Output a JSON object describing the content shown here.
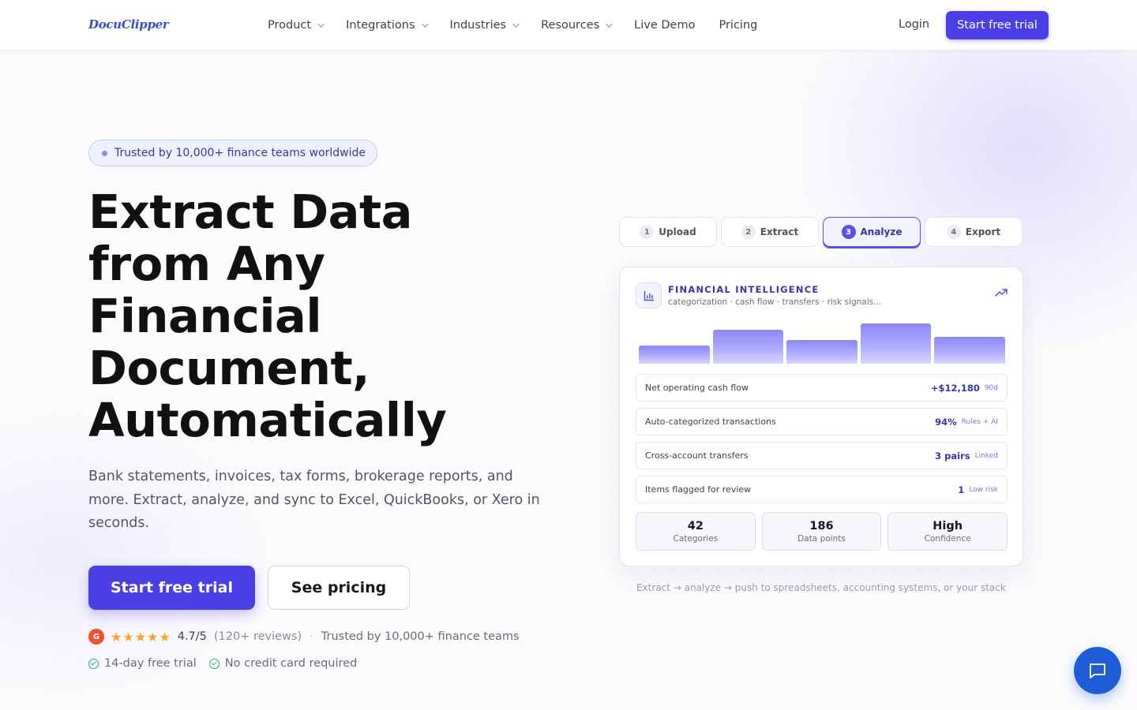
{
  "nav": {
    "logo": "DocuClipper",
    "links": [
      {
        "label": "Product",
        "dropdown": true
      },
      {
        "label": "Integrations",
        "dropdown": true
      },
      {
        "label": "Industries",
        "dropdown": true
      },
      {
        "label": "Resources",
        "dropdown": true
      },
      {
        "label": "Live Demo",
        "dropdown": false
      },
      {
        "label": "Pricing",
        "dropdown": false
      }
    ],
    "login": "Login",
    "cta": "Start free trial"
  },
  "hero": {
    "badge": "Trusted by 10,000+ finance teams worldwide",
    "headline_lines": [
      "Extract Data",
      "from Any",
      "Financial",
      "Document,",
      "Automatically"
    ],
    "subtext": "Bank statements, invoices, tax forms, brokerage reports, and more. Extract, analyze, and sync to Excel, QuickBooks, or Xero in seconds.",
    "primary_button": "Start free trial",
    "secondary_button": "See pricing",
    "rating": {
      "g2_label": "G",
      "stars": "★★★★★",
      "star_count": 4.7,
      "score": "4.7/5",
      "reviews": "(120+ reviews)",
      "separator": "·",
      "trusted": "Trusted by 10,000+ finance teams"
    },
    "perks": [
      "14-day free trial",
      "No credit card required"
    ]
  },
  "widget": {
    "steps": [
      {
        "num": "1",
        "label": "Upload",
        "active": false
      },
      {
        "num": "2",
        "label": "Extract",
        "active": false
      },
      {
        "num": "3",
        "label": "Analyze",
        "active": true
      },
      {
        "num": "4",
        "label": "Export",
        "active": false
      }
    ],
    "card": {
      "title": "FINANCIAL INTELLIGENCE",
      "subtitle": "categorization · cash flow · transfers · risk signals...",
      "bar_values": [
        0.37,
        0.7,
        0.48,
        0.82,
        0.55
      ],
      "rows": [
        {
          "label": "Net operating cash flow",
          "value": "+$12,180",
          "tag": "90d"
        },
        {
          "label": "Auto-categorized transactions",
          "value": "94%",
          "tag": "Rules + AI"
        },
        {
          "label": "Cross-account transfers",
          "value": "3 pairs",
          "tag": "Linked"
        },
        {
          "label": "Items flagged for review",
          "value": "1",
          "tag": "Low risk"
        }
      ],
      "stats": [
        {
          "value": "42",
          "label": "Categories"
        },
        {
          "value": "186",
          "label": "Data points"
        },
        {
          "value": "High",
          "label": "Confidence"
        }
      ]
    },
    "caption": "Extract → analyze → push to spreadsheets, accounting systems, or your stack"
  },
  "colors": {
    "accent": "#4b3ee6",
    "accent_text": "#3a34a8",
    "chat": "#1e5dd6",
    "g2": "#f05230",
    "star": "#f5a623",
    "check": "#22b07d"
  },
  "icons": {
    "chart": "bar-chart-icon",
    "trend": "trending-up-icon",
    "chat": "chat-bubble-icon"
  }
}
